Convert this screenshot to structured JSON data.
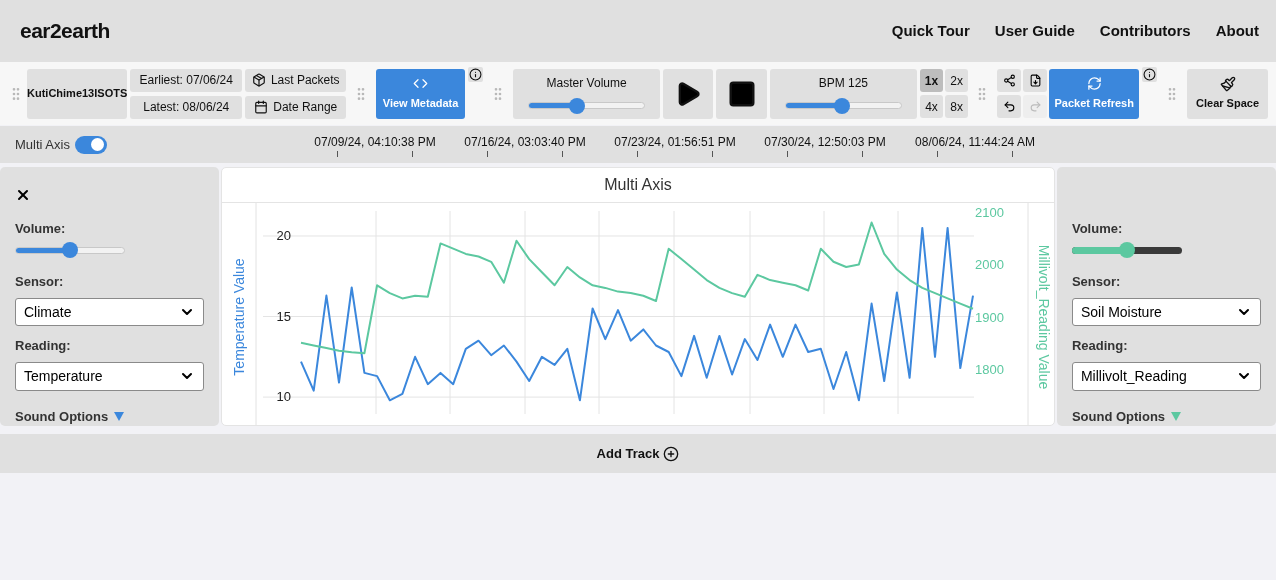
{
  "header": {
    "logo": "ear2earth",
    "nav": [
      "Quick Tour",
      "User Guide",
      "Contributors",
      "About"
    ]
  },
  "toolbar": {
    "device": "KutiChime13ISOTS",
    "earliest": "Earliest: 07/06/24",
    "latest": "Latest: 08/06/24",
    "last_packets": "Last Packets",
    "date_range": "Date Range",
    "view_metadata": "View Metadata",
    "master_volume": {
      "label": "Master Volume",
      "level": 0.42
    },
    "bpm": {
      "label": "BPM 125",
      "level": 0.49
    },
    "speeds": [
      {
        "label": "1x",
        "selected": true
      },
      {
        "label": "2x",
        "selected": false
      },
      {
        "label": "4x",
        "selected": false
      },
      {
        "label": "8x",
        "selected": false
      }
    ],
    "actions": [
      {
        "kind": "share",
        "disabled": false
      },
      {
        "kind": "download",
        "disabled": false
      },
      {
        "kind": "undo",
        "disabled": false
      },
      {
        "kind": "redo",
        "disabled": true
      }
    ],
    "packet_refresh": "Packet Refresh",
    "clear_space": "Clear Space"
  },
  "timeline": {
    "multi_axis": {
      "label": "Multi Axis",
      "on": true
    },
    "timestamps": [
      "07/09/24, 04:10:38 PM",
      "07/16/24, 03:03:40 PM",
      "07/23/24, 01:56:51 PM",
      "07/30/24, 12:50:03 PM",
      "08/06/24, 11:44:24 AM"
    ]
  },
  "tracks": [
    {
      "closable": true,
      "color": "#3b87dc",
      "kind": "light",
      "volume": {
        "label": "Volume:",
        "level": 0.5
      },
      "sensor": {
        "label": "Sensor:",
        "value": "Climate"
      },
      "reading": {
        "label": "Reading:",
        "value": "Temperature"
      },
      "sound_options": "Sound Options"
    },
    {
      "closable": false,
      "color": "#5cc8a0",
      "kind": "dark",
      "volume": {
        "label": "Volume:",
        "level": 0.5
      },
      "sensor": {
        "label": "Sensor:",
        "value": "Soil Moisture"
      },
      "reading": {
        "label": "Reading:",
        "value": "Millivolt_Reading"
      },
      "sound_options": "Sound Options"
    }
  ],
  "chart": {
    "chart_data": {
      "type": "line",
      "title": "Multi Axis",
      "grid": true,
      "ylabel": "Temperature Value",
      "y2label": "Millivolt_Reading Value",
      "ylim": [
        8.95,
        21.55
      ],
      "y2lim": [
        1714,
        2102
      ],
      "yticks": [
        10,
        15,
        20
      ],
      "y2ticks": [
        1800,
        1900,
        2000,
        2100
      ],
      "series": [
        {
          "color": "#3b87dc",
          "values": [
            12.2,
            10.4,
            16.3,
            10.9,
            16.8,
            11.5,
            11.3,
            9.8,
            10.2,
            12.5,
            10.8,
            11.5,
            10.8,
            13,
            13.5,
            12.6,
            13.2,
            12.2,
            11,
            12.5,
            12,
            13,
            9.8,
            15.5,
            13.6,
            15.4,
            13.5,
            14.2,
            13.2,
            12.8,
            11.3,
            13.8,
            11.2,
            13.8,
            11.4,
            13.6,
            12.3,
            14.5,
            12.5,
            14.5,
            12.8,
            13,
            10.5,
            12.8,
            9.8,
            15.8,
            11,
            16.5,
            11.2,
            20.5,
            12.5,
            20.5,
            11.8,
            16.3
          ]
        },
        {
          "color": "#5cc8a0",
          "axis": "y2",
          "values": [
            1850,
            1845,
            1840,
            1835,
            1832,
            1830,
            1960,
            1945,
            1935,
            1940,
            1938,
            2040,
            2030,
            2020,
            2015,
            2005,
            1965,
            2045,
            2010,
            1985,
            1960,
            1995,
            1975,
            1960,
            1955,
            1948,
            1945,
            1940,
            1930,
            2030,
            2010,
            1990,
            1970,
            1955,
            1945,
            1938,
            1980,
            1970,
            1965,
            1960,
            1950,
            2030,
            2005,
            1995,
            2000,
            2080,
            2020,
            1990,
            1970,
            1955,
            1945,
            1935,
            1925,
            1915
          ]
        }
      ]
    }
  },
  "add_track": "Add Track"
}
